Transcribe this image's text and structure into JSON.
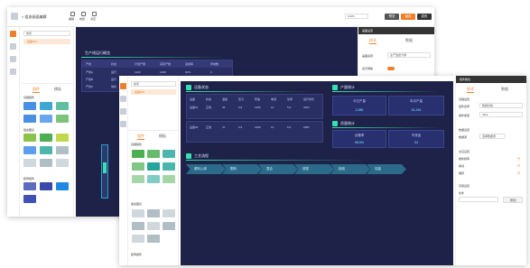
{
  "app": {
    "back_title": "< 组态画面编辑",
    "search_placeholder": "搜索",
    "tree_item": "画面001",
    "tabs": [
      "组件",
      "模板"
    ],
    "component_groups": [
      "基础组件",
      "组态图表",
      "装饰组件"
    ],
    "toolbar": [
      "撤销",
      "恢复",
      "清空"
    ],
    "zoom": "100%",
    "preview": "预览",
    "save": "保存",
    "publish": "发布"
  },
  "back_window": {
    "section_title": "生产线运行概览",
    "table_headers": [
      "产线",
      "状态",
      "计划产量",
      "实际产量",
      "完成率",
      "异常数"
    ],
    "table_rows": [
      [
        "产线A",
        "运行",
        "1200",
        "1080",
        "90%",
        "0"
      ],
      [
        "产线B",
        "运行",
        "980",
        "900",
        "92%",
        "1"
      ],
      [
        "产线C",
        "停机",
        "760",
        "420",
        "55%",
        "3"
      ]
    ],
    "props_title": "画面设置",
    "props_tabs": [
      "样式",
      "数据"
    ],
    "prop_label_name": "画面名称",
    "prop_value_name": "生产监控大屏",
    "prop_label_switch": "显示网格"
  },
  "front_window": {
    "tree_item": "画面002",
    "left_section_title": "设备状态",
    "left_table_headers": [
      "设备",
      "状态",
      "温度",
      "压力",
      "转速",
      "电流",
      "功率",
      "运行时长"
    ],
    "left_table_row1": [
      "设备01",
      "正常",
      "45",
      "0.8",
      "1450",
      "12",
      "5.5",
      "320h"
    ],
    "left_table_row2": [
      "设备02",
      "正常",
      "47",
      "0.9",
      "1460",
      "13",
      "5.6",
      "298h"
    ],
    "right_section_title": "产量统计",
    "kpi_row1": [
      {
        "title": "今日产量",
        "value": "2,380"
      },
      {
        "title": "本月产量",
        "value": "61,240"
      }
    ],
    "right_section_title2": "质量统计",
    "kpi_row2": [
      {
        "title": "合格率",
        "value": "98.6%"
      },
      {
        "title": "不良品",
        "value": "34"
      }
    ],
    "flow_title": "工艺流程",
    "flow_steps": [
      "原料入库",
      "配料",
      "混合",
      "成型",
      "检验",
      "包装"
    ],
    "props_title": "组件属性",
    "props_tabs": [
      "样式",
      "数据"
    ],
    "prop_sections": [
      "基础设置",
      "数据设置",
      "交互设置",
      "高级设置"
    ],
    "prop_labels": [
      "组件名称",
      "组件类型",
      "数据源",
      "刷新频率",
      "联动",
      "跳转",
      "条件"
    ],
    "prop_values": [
      "数据表格",
      "table",
      "选择数据源",
      "开",
      "开",
      "开"
    ],
    "prop_button": "添加"
  },
  "colors": {
    "accent": "#ef7f2a",
    "canvas_bg": "#1e2248",
    "table_bg": "#2a2f63",
    "line_green": "#36e0b0"
  }
}
